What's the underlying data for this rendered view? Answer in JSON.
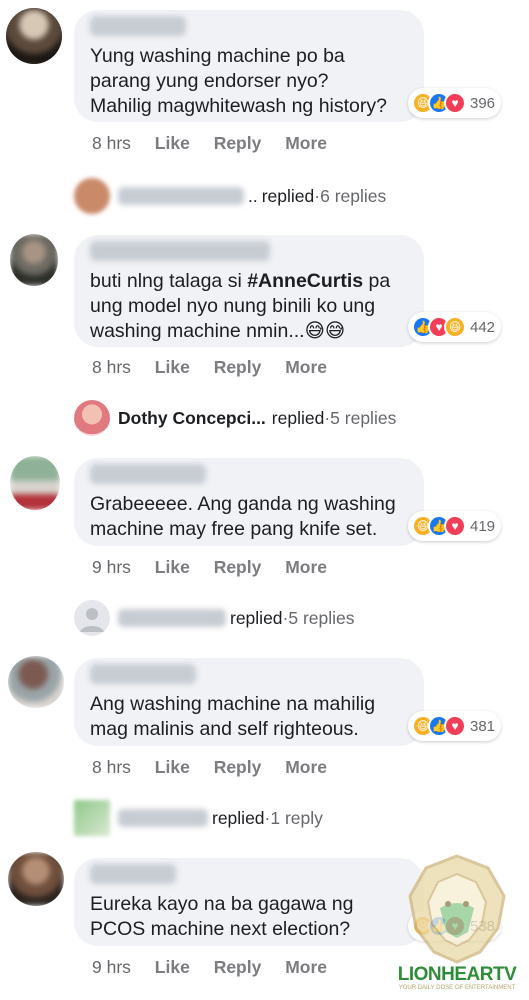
{
  "comments": [
    {
      "text_lines": [
        "Yung washing machine po ba",
        "parang yung endorser nyo?",
        "Mahilig magwhitewash ng history?"
      ],
      "reaction_count": "396",
      "reactions": [
        "haha",
        "like",
        "love"
      ],
      "time": "8 hrs",
      "like": "Like",
      "reply": "Reply",
      "more": "More"
    },
    {
      "text_lines": [
        "buti nlng talaga si ",
        "#AnneCurtis",
        " pa",
        "ung model nyo nung binili ko ung",
        "washing machine nmin...😅😅"
      ],
      "reaction_count": "442",
      "reactions": [
        "like",
        "love",
        "haha"
      ],
      "time": "8 hrs",
      "like": "Like",
      "reply": "Reply",
      "more": "More"
    },
    {
      "text_lines": [
        "Grabeeeee. Ang ganda ng washing",
        "machine may free pang knife set."
      ],
      "reaction_count": "419",
      "reactions": [
        "haha",
        "like",
        "love"
      ],
      "time": "9 hrs",
      "like": "Like",
      "reply": "Reply",
      "more": "More"
    },
    {
      "text_lines": [
        "Ang washing machine na mahilig",
        "mag malinis and self righteous."
      ],
      "reaction_count": "381",
      "reactions": [
        "haha",
        "like",
        "love"
      ],
      "time": "8 hrs",
      "like": "Like",
      "reply": "Reply",
      "more": "More"
    },
    {
      "text_lines": [
        "Eureka kayo na ba gagawa ng",
        "PCOS machine next election?"
      ],
      "reaction_count": "538",
      "reactions": [
        "haha",
        "like",
        "love"
      ],
      "time": "9 hrs",
      "like": "Like",
      "reply": "Reply",
      "more": "More"
    }
  ],
  "reply_rows": [
    {
      "name_suffix": "..",
      "replied": "replied",
      "sep": " · ",
      "count": "6 replies"
    },
    {
      "name": "Dothy Concepci...",
      "replied": "replied",
      "sep": " · ",
      "count": "5 replies"
    },
    {
      "replied": "replied",
      "sep": " · ",
      "count": "5 replies"
    },
    {
      "replied": "replied",
      "sep": " · ",
      "count": "1 reply"
    }
  ],
  "watermark": {
    "brand": "LIONHEARTV",
    "tagline": "YOUR DAILY DOSE OF ENTERTAINMENT"
  },
  "colors": {
    "bubble": "#f0f2f5",
    "like": "#1877f2",
    "love": "#f33e58",
    "haha": "#f7b125",
    "secondary_text": "#65676b",
    "brand_green": "#2f8c3a"
  }
}
